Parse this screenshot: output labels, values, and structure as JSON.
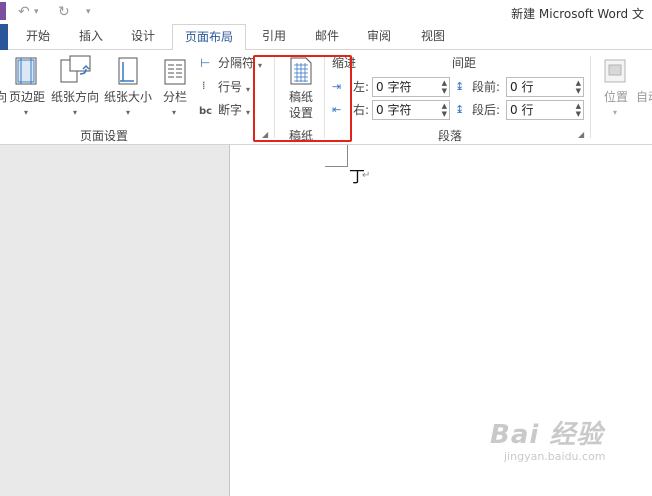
{
  "window": {
    "title": "新建 Microsoft Word 文",
    "qat": {
      "undo_icon": "↶",
      "undo_caret": "▾",
      "redo_icon": "↻",
      "customize": "▾"
    }
  },
  "tabs": [
    {
      "label": "开始",
      "active": false
    },
    {
      "label": "插入",
      "active": false
    },
    {
      "label": "设计",
      "active": false
    },
    {
      "label": "页面布局",
      "active": true
    },
    {
      "label": "引用",
      "active": false
    },
    {
      "label": "邮件",
      "active": false
    },
    {
      "label": "审阅",
      "active": false
    },
    {
      "label": "视图",
      "active": false
    }
  ],
  "ribbon": {
    "page_setup": {
      "title": "页面设置",
      "partial_label": "向",
      "margins": "页边距",
      "orientation": "纸张方向",
      "size": "纸张大小",
      "columns": "分栏",
      "breaks": "分隔符",
      "line_numbers": "行号",
      "hyphenation": "断字"
    },
    "manuscript": {
      "title": "稿纸",
      "button_line1": "稿纸",
      "button_line2": "设置"
    },
    "paragraph": {
      "title": "段落",
      "indent_header": "缩进",
      "spacing_header": "间距",
      "left_label": "左:",
      "right_label": "右:",
      "left_value": "0 字符",
      "right_value": "0 字符",
      "before_label": "段前:",
      "after_label": "段后:",
      "before_value": "0 行",
      "after_value": "0 行"
    },
    "arrange": {
      "position": "位置",
      "wrap_partial": "自动"
    }
  },
  "document": {
    "cursor_glyph": "丁",
    "paragraph_mark": "↵"
  },
  "watermark": {
    "brand": "Bai 经验",
    "url": "jingyan.baidu.com"
  },
  "colors": {
    "accent": "#2b579a",
    "highlight": "#e2231a"
  }
}
